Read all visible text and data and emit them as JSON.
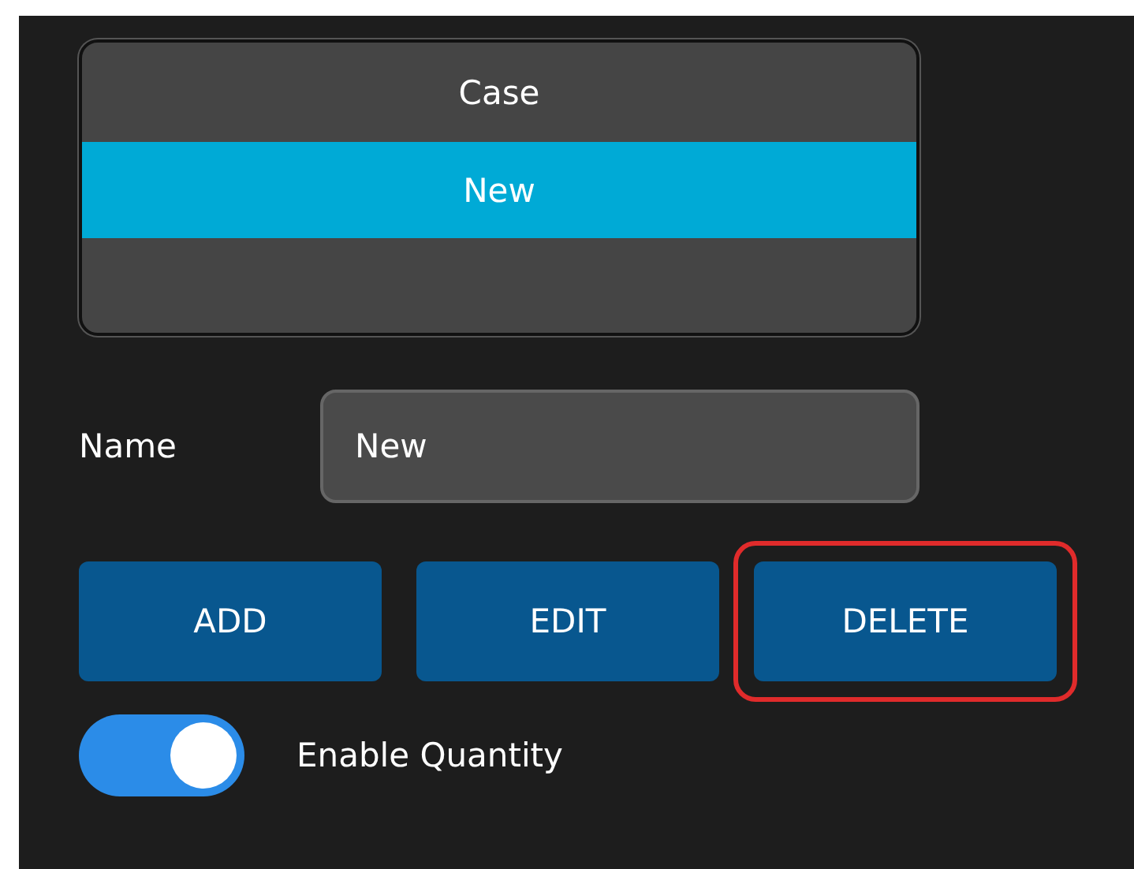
{
  "list": {
    "items": [
      {
        "label": "Case",
        "selected": false
      },
      {
        "label": "New",
        "selected": true
      },
      {
        "selected": false
      }
    ]
  },
  "name_field": {
    "label": "Name",
    "value": "New"
  },
  "buttons": [
    {
      "label": "ADD",
      "highlighted": false
    },
    {
      "label": "EDIT",
      "highlighted": false
    },
    {
      "label": "DELETE",
      "highlighted": true
    }
  ],
  "toggle": {
    "label": "Enable Quantity",
    "on": true
  }
}
